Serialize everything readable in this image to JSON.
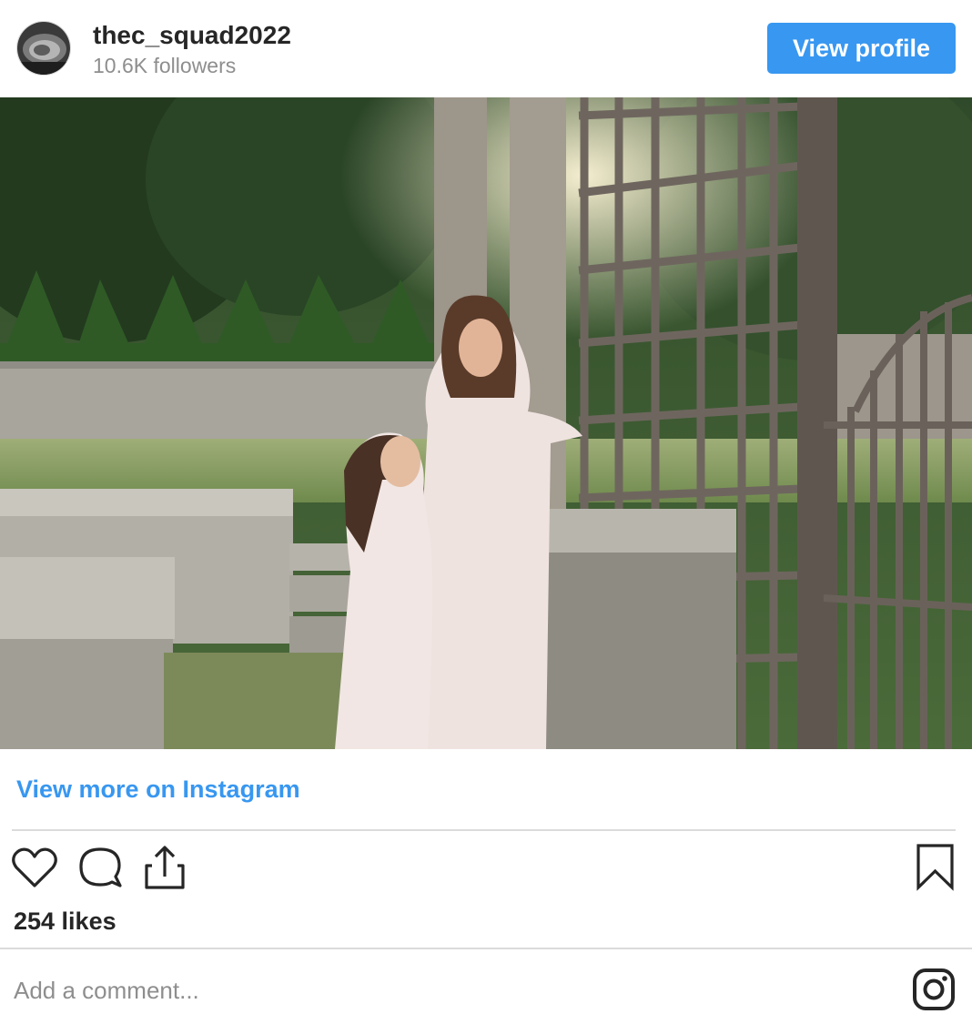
{
  "header": {
    "username": "thec_squad2022",
    "followers": "10.6K followers",
    "view_profile_label": "View profile"
  },
  "post": {
    "image_alt": "Instagram post photo"
  },
  "links": {
    "view_more": "View more on Instagram"
  },
  "engagement": {
    "likes": "254 likes"
  },
  "comment": {
    "placeholder": "Add a comment..."
  },
  "icons": {
    "like": "heart-icon",
    "comment": "comment-icon",
    "share": "share-icon",
    "save": "bookmark-icon",
    "brand": "instagram-icon"
  },
  "colors": {
    "accent": "#3897f0",
    "text": "#262626",
    "secondary": "#8e8e8e",
    "divider": "#dbdbdb"
  }
}
